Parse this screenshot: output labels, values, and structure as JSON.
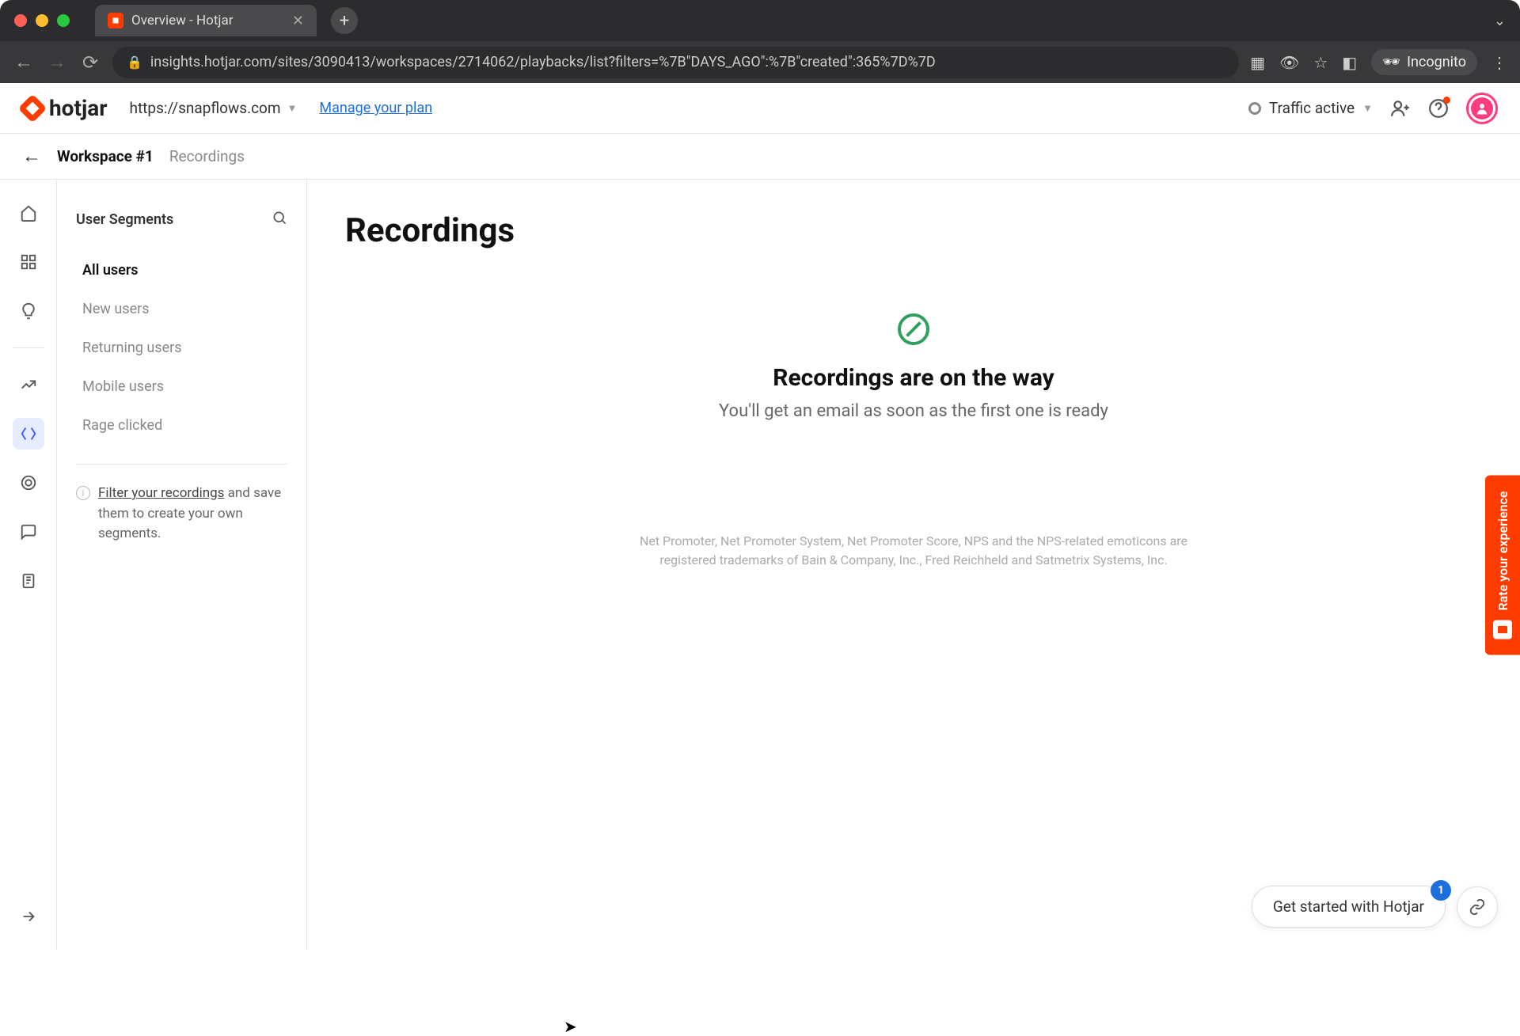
{
  "browser": {
    "tab_title": "Overview - Hotjar",
    "url": "insights.hotjar.com/sites/3090413/workspaces/2714062/playbacks/list?filters=%7B\"DAYS_AGO\":%7B\"created\":365%7D%7D",
    "incognito_label": "Incognito"
  },
  "header": {
    "logo_text": "hotjar",
    "site": "https://snapflows.com",
    "plan_link": "Manage your plan",
    "traffic_label": "Traffic active"
  },
  "breadcrumb": {
    "workspace": "Workspace #1",
    "page": "Recordings"
  },
  "segments": {
    "title": "User Segments",
    "items": [
      "All users",
      "New users",
      "Returning users",
      "Mobile users",
      "Rage clicked"
    ],
    "active_index": 0,
    "tip_link_text": "Filter your recordings",
    "tip_rest": " and save them to create your own segments."
  },
  "main": {
    "title": "Recordings",
    "empty_title": "Recordings are on the way",
    "empty_sub": "You'll get an email as soon as the first one is ready",
    "legal": "Net Promoter, Net Promoter System, Net Promoter Score, NPS and the NPS-related emoticons are registered trademarks of Bain & Company, Inc., Fred Reichheld and Satmetrix Systems, Inc."
  },
  "feedback": {
    "label": "Rate your experience"
  },
  "floating": {
    "get_started": "Get started with Hotjar",
    "badge": "1"
  }
}
